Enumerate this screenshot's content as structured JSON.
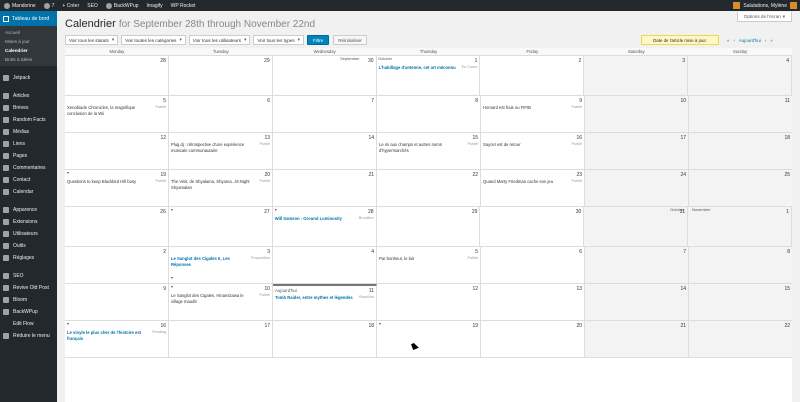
{
  "adminbar": {
    "items": [
      "Mandorine",
      "7",
      "+ Créer",
      "SEO",
      "BackWPup",
      "Imagify",
      "WP Rocket"
    ],
    "account": "Salutations, Mylène"
  },
  "sidebar": {
    "head": "Tableau de bord",
    "submenu": [
      "Accueil",
      "Mises à jour",
      "Calendrier",
      "Brots à tdées"
    ],
    "items": [
      "Jetpack",
      "Articles",
      "Brèves",
      "Random Facts",
      "Médias",
      "Liens",
      "Pages",
      "Commentaires",
      "Contact",
      "Calendar",
      "Apparence",
      "Extensions",
      "Utilisateurs",
      "Outils",
      "Réglages",
      "SEO",
      "Revive Old Post",
      "Bloom",
      "BackWPup",
      "Edit Flow",
      "Réduire le menu"
    ]
  },
  "screen_options": "Options de l'écran",
  "title": {
    "main": "Calendrier",
    "sub": "for September 28th through November 22nd"
  },
  "filters": {
    "statuses": "Voir tous les statuts",
    "categories": "Voir toutes les catégories",
    "users": "Voir tous les utilisateurs",
    "types": "Voir tous les types",
    "filter": "Filtre",
    "reset": "Réinitialiser"
  },
  "notice": "Date de l'article mise à jour.",
  "nav": {
    "prev2": "«",
    "prev": "‹",
    "today": "Aujourd'hui",
    "next": "›",
    "next2": "»"
  },
  "days": [
    "Monday",
    "Tuesday",
    "Wednesday",
    "Thursday",
    "Friday",
    "Saturday",
    "Sunday"
  ],
  "months": {
    "september": "September",
    "october": "October",
    "november": "November"
  },
  "today_label": "Aujourd'hui",
  "weeks": [
    {
      "nums": [
        "28",
        "29",
        "30",
        "1",
        "2",
        "3",
        "4"
      ],
      "posts": [
        null,
        null,
        null,
        {
          "t": "L'habillage d'antenne, cet art méconnu",
          "s": "En Cours",
          "sched": true
        },
        null,
        null,
        null
      ]
    },
    {
      "nums": [
        "5",
        "6",
        "7",
        "8",
        "9",
        "10",
        "11"
      ],
      "posts": [
        {
          "t": "Xenobiade Chronicles, la magnifique conclusion de la Wii",
          "s": "Publié"
        },
        null,
        null,
        null,
        {
          "t": "Homard est frais ou FIFIB",
          "s": "Publié"
        },
        null,
        null
      ]
    },
    {
      "nums": [
        "12",
        "13",
        "14",
        "15",
        "16",
        "17",
        "18"
      ],
      "posts": [
        null,
        {
          "t": "Plug.dj : rétrospective d'une expérience musicale communautaire",
          "s": "Publié"
        },
        null,
        {
          "t": "Le mi aux champs et autres noms d'hypermarchés",
          "s": "Publié"
        },
        {
          "t": "Saycet est de retour",
          "s": "Publié"
        },
        null,
        null
      ]
    },
    {
      "nums": [
        "19",
        "20",
        "21",
        "22",
        "23",
        "24",
        "25"
      ],
      "posts": [
        {
          "t": "Questions to keep Blackbird Hill busy",
          "s": "Publié"
        },
        {
          "t": "The Visit, de Shyalama, Shyama...M.Night Shyamalan",
          "s": "Publié"
        },
        null,
        null,
        {
          "t": "Quand Marty Friedman cache son jeu",
          "s": "Publié"
        },
        null,
        null
      ]
    },
    {
      "nums": [
        "26",
        "27",
        "28",
        "29",
        "30",
        "31",
        "1"
      ],
      "posts": [
        null,
        null,
        {
          "t": "Will Samson - Ground Luminosity",
          "s": "Brouillon",
          "sched": true
        },
        null,
        null,
        null,
        null
      ]
    },
    {
      "nums": [
        "2",
        "3",
        "4",
        "5",
        "6",
        "7",
        "8"
      ],
      "posts": [
        null,
        {
          "t": "Le Sanglot des Cigales II, Les Réponses",
          "s": "Proposition",
          "sched": true
        },
        null,
        {
          "t": "Par bonheur, le lait",
          "s": "Publié"
        },
        null,
        null,
        null
      ]
    },
    {
      "nums": [
        "9",
        "10",
        "11",
        "12",
        "13",
        "14",
        "15"
      ],
      "posts": [
        null,
        {
          "t": "Le Sanglot des Cigales, Hinamizawa le village maudit",
          "s": "Publié"
        },
        {
          "t": "Tomb Raider, entre mythes et légendes",
          "s": "Brouillon",
          "sched": true
        },
        null,
        null,
        null,
        null
      ]
    },
    {
      "nums": [
        "16",
        "17",
        "18",
        "19",
        "20",
        "21",
        "22"
      ],
      "posts": [
        {
          "t": "Le vinyle le plus cher de l'histoire est français",
          "s": "Pending",
          "sched": true
        },
        null,
        null,
        null,
        null,
        null,
        null
      ]
    }
  ]
}
